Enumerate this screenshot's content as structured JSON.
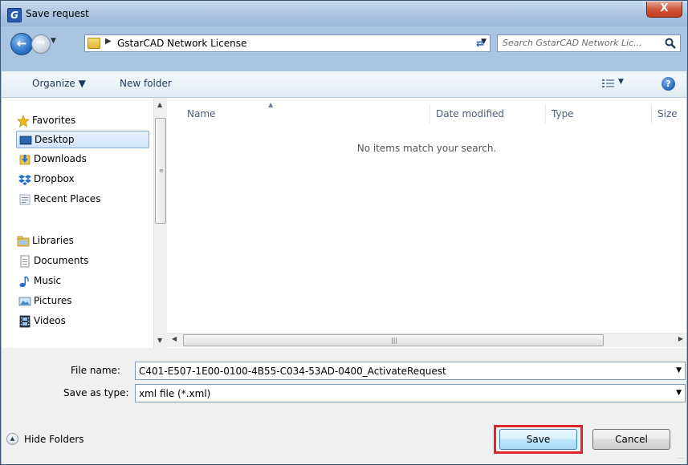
{
  "window": {
    "title": "Save request",
    "app_icon_letter": "G",
    "close_label": "X"
  },
  "navigation": {
    "address_path": "GstarCAD Network License",
    "search_placeholder": "Search GstarCAD Network Lic..."
  },
  "toolbar": {
    "organize_label": "Organize ▼",
    "new_folder_label": "New folder"
  },
  "nav_pane": {
    "favorites_header": "Favorites",
    "favorites": [
      {
        "label": "Desktop",
        "icon": "desktop-icon",
        "selected": true
      },
      {
        "label": "Downloads",
        "icon": "downloads-icon",
        "selected": false
      },
      {
        "label": "Dropbox",
        "icon": "dropbox-icon",
        "selected": false
      },
      {
        "label": "Recent Places",
        "icon": "recent-places-icon",
        "selected": false
      }
    ],
    "libraries_header": "Libraries",
    "libraries": [
      {
        "label": "Documents",
        "icon": "documents-icon"
      },
      {
        "label": "Music",
        "icon": "music-icon"
      },
      {
        "label": "Pictures",
        "icon": "pictures-icon"
      },
      {
        "label": "Videos",
        "icon": "videos-icon"
      }
    ]
  },
  "file_list": {
    "columns": [
      "Name",
      "Date modified",
      "Type",
      "Size"
    ],
    "empty_message": "No items match your search."
  },
  "form": {
    "file_name_label": "File name:",
    "file_name_value": "C401-E507-1E00-0100-4B55-C034-53AD-0400_ActivateRequest",
    "save_type_label": "Save as type:",
    "save_type_value": "xml file (*.xml)"
  },
  "footer": {
    "hide_folders_label": "Hide Folders",
    "save_label": "Save",
    "cancel_label": "Cancel"
  },
  "colors": {
    "highlight_border": "#e0262a",
    "toolbar_text": "#1e395b"
  }
}
